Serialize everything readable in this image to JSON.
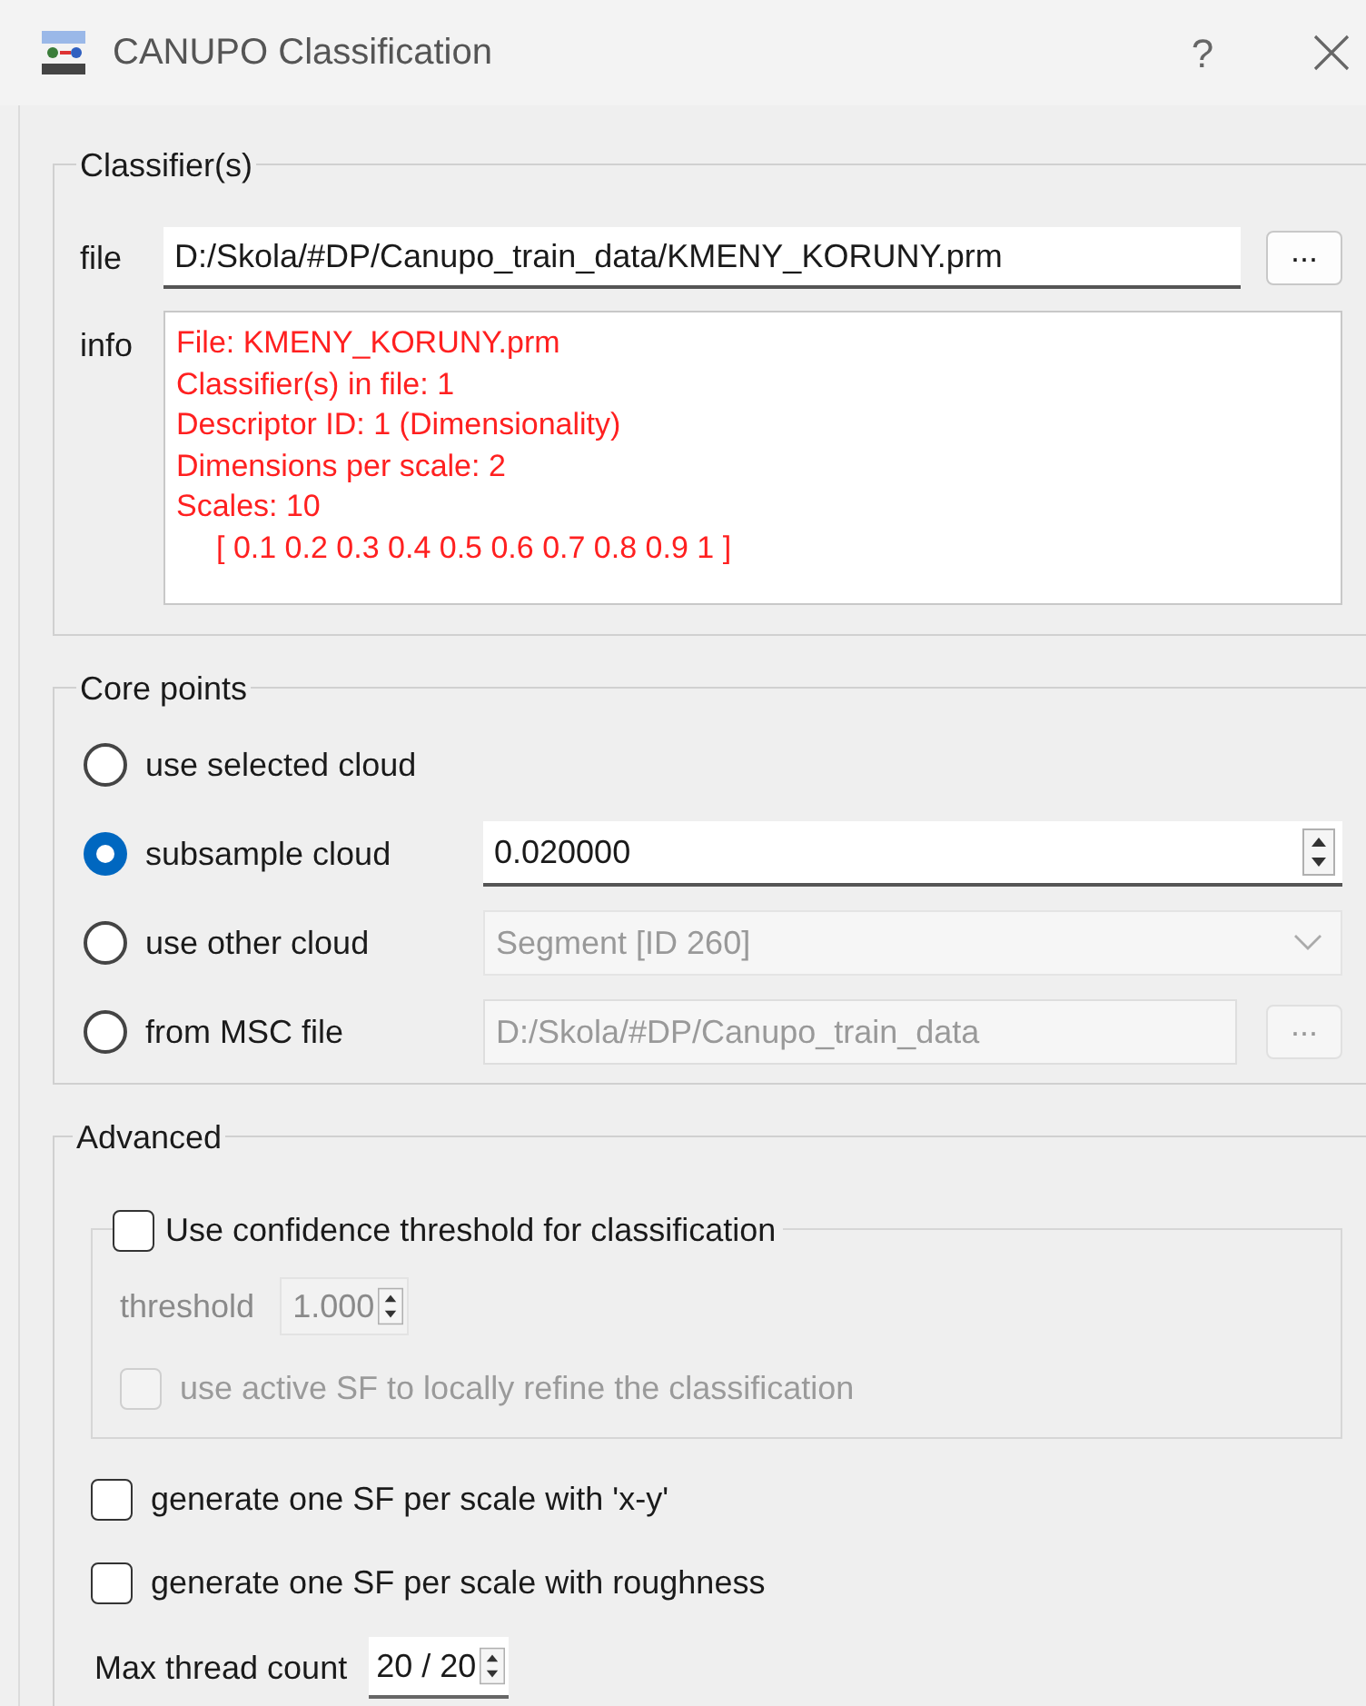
{
  "window": {
    "title": "CANUPO Classification",
    "help": "?"
  },
  "classifier": {
    "title": "Classifier(s)",
    "file_label": "file",
    "file_value": "D:/Skola/#DP/Canupo_train_data/KMENY_KORUNY.prm",
    "browse": "...",
    "info_label": "info",
    "info_lines": [
      {
        "text": "File: KMENY_KORUNY.prm",
        "indent": false
      },
      {
        "text": "Classifier(s) in file: 1",
        "indent": false
      },
      {
        "text": "Descriptor ID: 1 (Dimensionality)",
        "indent": false
      },
      {
        "text": "Dimensions per scale: 2",
        "indent": false
      },
      {
        "text": "Scales: 10",
        "indent": false
      },
      {
        "text": "[ 0.1 0.2 0.3 0.4 0.5 0.6 0.7 0.8 0.9 1 ]",
        "indent": true
      }
    ]
  },
  "core_points": {
    "title": "Core points",
    "options": [
      {
        "label": "use selected cloud",
        "selected": false,
        "kind": "none"
      },
      {
        "label": "subsample cloud",
        "selected": true,
        "kind": "spin",
        "value": "0.020000",
        "disabled": false
      },
      {
        "label": "use other cloud",
        "selected": false,
        "kind": "combo",
        "value": "Segment [ID 260]",
        "disabled": true
      },
      {
        "label": "from MSC file",
        "selected": false,
        "kind": "path",
        "value": "D:/Skola/#DP/Canupo_train_data",
        "button": "...",
        "disabled": true
      }
    ]
  },
  "advanced": {
    "title": "Advanced",
    "confidence": {
      "label": "Use confidence threshold for classification",
      "checked": false
    },
    "threshold": {
      "label": "threshold",
      "value": "1.000",
      "disabled": true
    },
    "refine": {
      "label": "use active SF to locally refine the classification",
      "checked": false,
      "disabled": true
    },
    "options": [
      {
        "label": "generate one SF per scale with 'x-y'",
        "checked": false
      },
      {
        "label": "generate one SF per scale with roughness",
        "checked": false
      }
    ],
    "max_threads": {
      "label": "Max thread count",
      "value": "20 / 20"
    }
  }
}
